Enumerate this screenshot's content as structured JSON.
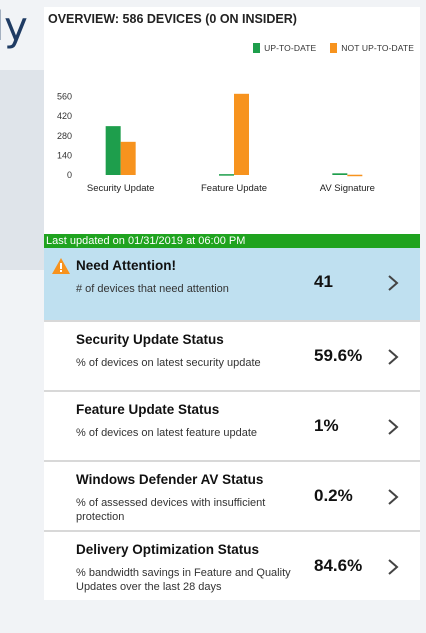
{
  "background": {
    "fragment_text": "ly"
  },
  "overview": {
    "title": "OVERVIEW: 586 DEVICES (0 ON INSIDER)",
    "legend": [
      {
        "label": "UP-TO-DATE",
        "color": "#16a34a"
      },
      {
        "label": "NOT UP-TO-DATE",
        "color": "#f7931e"
      }
    ]
  },
  "chart_data": {
    "type": "bar",
    "categories": [
      "Security Update",
      "Feature Update",
      "AV Signature"
    ],
    "series": [
      {
        "name": "UP-TO-DATE",
        "color": "#1e9e4c",
        "values": [
          349,
          6,
          12
        ]
      },
      {
        "name": "NOT UP-TO-DATE",
        "color": "#f7931e",
        "values": [
          237,
          580,
          2
        ]
      }
    ],
    "yticks": [
      0,
      140,
      280,
      420,
      560
    ],
    "ylim": [
      0,
      600
    ],
    "title": "",
    "xlabel": "",
    "ylabel": ""
  },
  "status_strip": {
    "text": "Last updated on 01/31/2019 at 06:00 PM"
  },
  "rows": [
    {
      "title": "Need Attention!",
      "sub": "# of devices that need attention",
      "value": "41",
      "icon": "warning-icon"
    },
    {
      "title": "Security Update Status",
      "sub": "% of devices on latest security update",
      "value": "59.6%"
    },
    {
      "title": "Feature Update Status",
      "sub": "% of devices on latest feature update",
      "value": "1%"
    },
    {
      "title": "Windows Defender AV Status",
      "sub": "% of assessed devices with insufficient protection",
      "value": "0.2%"
    },
    {
      "title": "Delivery Optimization Status",
      "sub": "% bandwidth savings in Feature and Quality Updates over the last 28 days",
      "value": "84.6%"
    }
  ]
}
